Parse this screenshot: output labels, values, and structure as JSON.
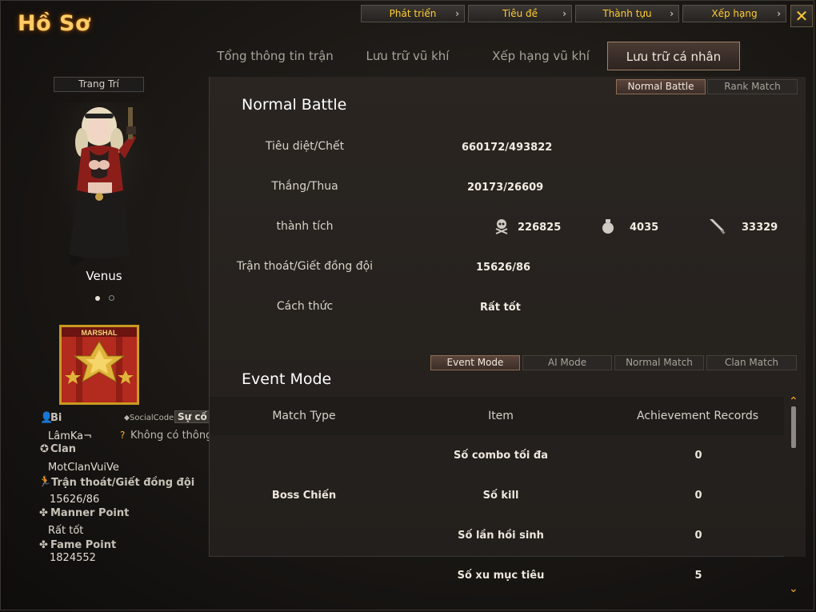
{
  "window": {
    "title": "Hồ Sơ",
    "close_label": "✕"
  },
  "top_nav": [
    {
      "label": "Phát triển"
    },
    {
      "label": "Tiêu đề"
    },
    {
      "label": "Thành tựu"
    },
    {
      "label": "Xếp hạng"
    }
  ],
  "tabs": [
    {
      "label": "Tổng thông tin trận đấu"
    },
    {
      "label": "Lưu trữ vũ khí"
    },
    {
      "label": "Xếp hạng vũ khí"
    },
    {
      "label": "Lưu trữ cá nhân"
    }
  ],
  "profile": {
    "decor_button": "Trang Trí",
    "character_name": "Venus",
    "rank_label": "MARSHAL",
    "nickname_label": "Bi",
    "nickname": "LâmKa¬",
    "social_code_label": "SocialCode",
    "social_code_value": "Sự cố",
    "social_info": "Không có thông tin",
    "clan_label": "Clan",
    "clan": "MotClanVuiVe",
    "escape_label": "Trận thoát/Giết đồng đội",
    "escape_value": "15626/86",
    "manner_label": "Manner Point",
    "manner_value": "Rất tốt",
    "fame_label": "Fame Point",
    "fame_value": "1824552"
  },
  "mode_tabs": {
    "normal": "Normal Battle",
    "rank": "Rank Match",
    "active": "normal"
  },
  "normal_battle": {
    "title": "Normal Battle",
    "kd_label": "Tiêu diệt/Chết",
    "kd_value": "660172/493822",
    "wl_label": "Thắng/Thua",
    "wl_value": "20173/26609",
    "ach_label": "thành tích",
    "ach_skull": "226825",
    "ach_grenade": "4035",
    "ach_knife": "33329",
    "escape_label": "Trận thoát/Giết đồng đội",
    "escape_value": "15626/86",
    "manner_label": "Cách thức",
    "manner_value": "Rất tốt"
  },
  "event_tabs": [
    {
      "label": "Event Mode"
    },
    {
      "label": "AI Mode"
    },
    {
      "label": "Normal Match"
    },
    {
      "label": "Clan Match"
    }
  ],
  "event_mode": {
    "title": "Event Mode",
    "columns": [
      "Match Type",
      "Item",
      "Achievement Records"
    ],
    "group": "Boss Chiến",
    "rows": [
      {
        "item": "Số combo tối đa",
        "value": "0"
      },
      {
        "item": "Số kill",
        "value": "0"
      },
      {
        "item": "Số lần hồi sinh",
        "value": "0"
      },
      {
        "item": "Số xu mục tiêu",
        "value": "5"
      }
    ]
  }
}
